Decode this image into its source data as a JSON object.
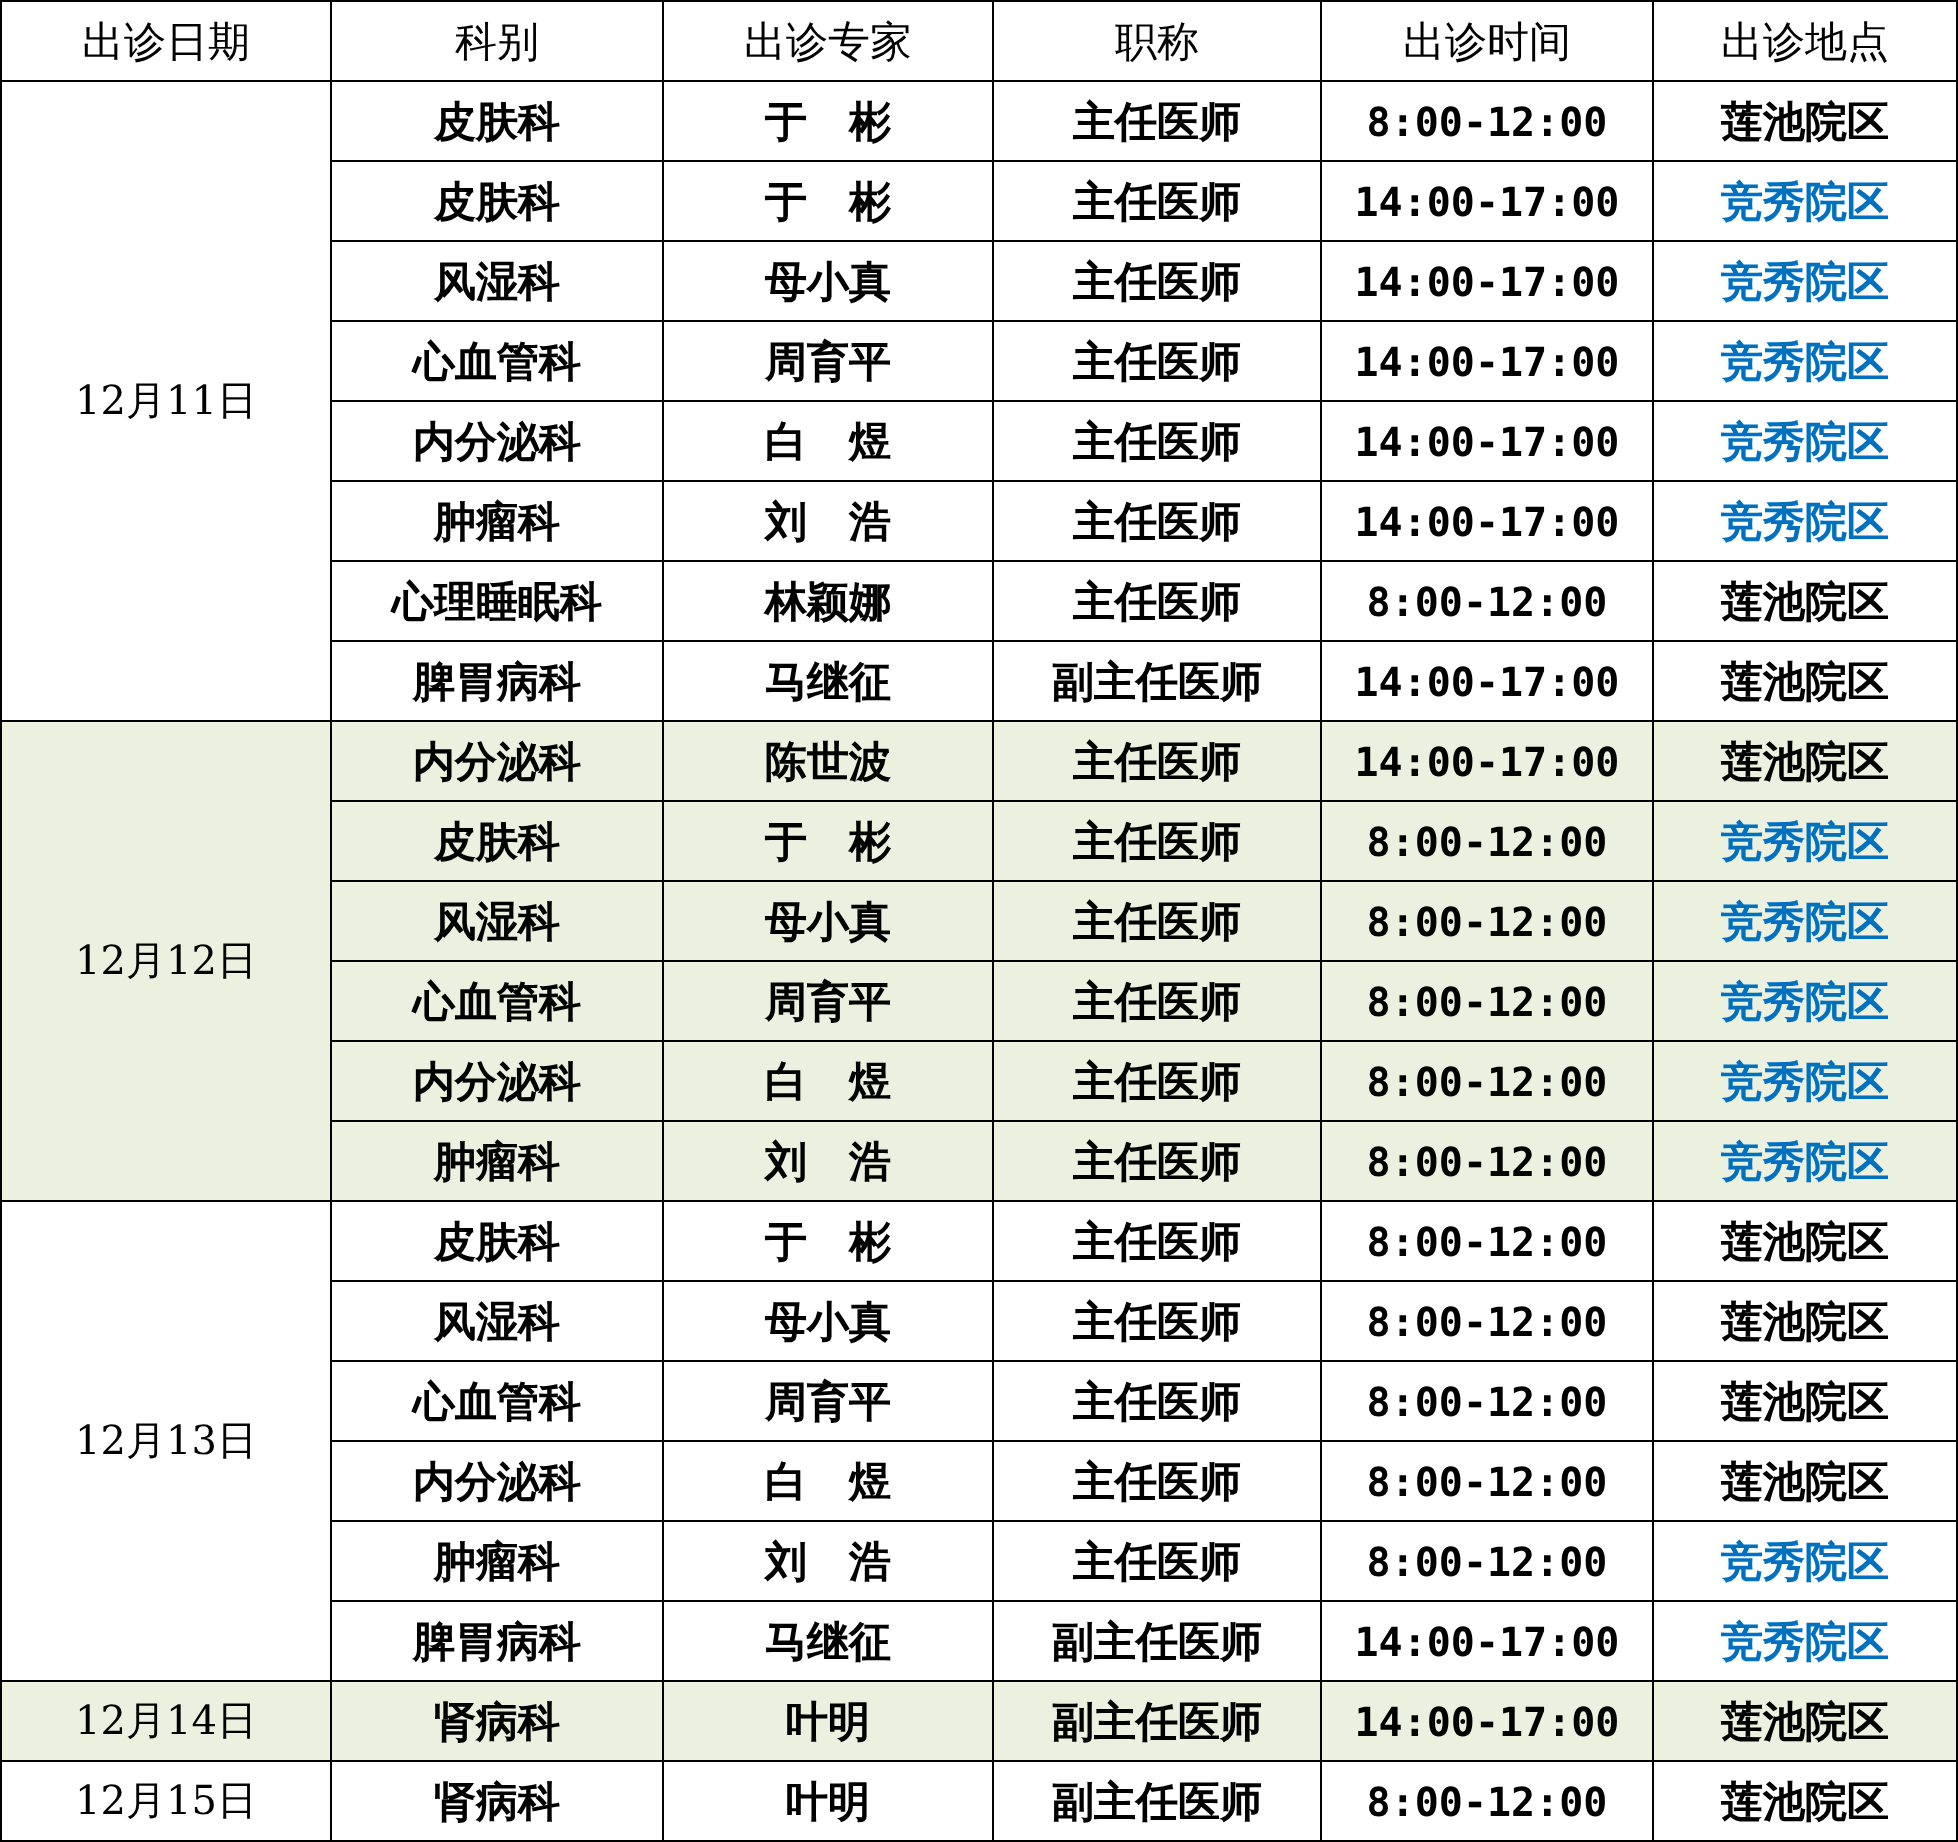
{
  "table": {
    "columns": [
      "出诊日期",
      "科别",
      "出诊专家",
      "职称",
      "出诊时间",
      "出诊地点"
    ],
    "groups": [
      {
        "date": "12月11日",
        "shaded": false,
        "rows": [
          {
            "dept": "皮肤科",
            "doctor": "于　彬",
            "title": "主任医师",
            "time": "8:00-12:00",
            "location": {
              "text": "莲池院区",
              "color": "#000000"
            }
          },
          {
            "dept": "皮肤科",
            "doctor": "于　彬",
            "title": "主任医师",
            "time": "14:00-17:00",
            "location": {
              "text": "竞秀院区",
              "color": "#0070c0"
            }
          },
          {
            "dept": "风湿科",
            "doctor": "母小真",
            "title": "主任医师",
            "time": "14:00-17:00",
            "location": {
              "text": "竞秀院区",
              "color": "#0070c0"
            }
          },
          {
            "dept": "心血管科",
            "doctor": "周育平",
            "title": "主任医师",
            "time": "14:00-17:00",
            "location": {
              "text": "竞秀院区",
              "color": "#0070c0"
            }
          },
          {
            "dept": "内分泌科",
            "doctor": "白　煜",
            "title": "主任医师",
            "time": "14:00-17:00",
            "location": {
              "text": "竞秀院区",
              "color": "#0070c0"
            }
          },
          {
            "dept": "肿瘤科",
            "doctor": "刘　浩",
            "title": "主任医师",
            "time": "14:00-17:00",
            "location": {
              "text": "竞秀院区",
              "color": "#0070c0"
            }
          },
          {
            "dept": "心理睡眠科",
            "doctor": "林颖娜",
            "title": "主任医师",
            "time": "8:00-12:00",
            "location": {
              "text": "莲池院区",
              "color": "#000000"
            }
          },
          {
            "dept": "脾胃病科",
            "doctor": "马继征",
            "title": "副主任医师",
            "time": "14:00-17:00",
            "location": {
              "text": "莲池院区",
              "color": "#000000"
            }
          }
        ]
      },
      {
        "date": "12月12日",
        "shaded": true,
        "rows": [
          {
            "dept": "内分泌科",
            "doctor": "陈世波",
            "title": "主任医师",
            "time": "14:00-17:00",
            "location": {
              "text": "莲池院区",
              "color": "#000000"
            }
          },
          {
            "dept": "皮肤科",
            "doctor": "于　彬",
            "title": "主任医师",
            "time": "8:00-12:00",
            "location": {
              "text": "竞秀院区",
              "color": "#0070c0"
            }
          },
          {
            "dept": "风湿科",
            "doctor": "母小真",
            "title": "主任医师",
            "time": "8:00-12:00",
            "location": {
              "text": "竞秀院区",
              "color": "#0070c0"
            }
          },
          {
            "dept": "心血管科",
            "doctor": "周育平",
            "title": "主任医师",
            "time": "8:00-12:00",
            "location": {
              "text": "竞秀院区",
              "color": "#0070c0"
            }
          },
          {
            "dept": "内分泌科",
            "doctor": "白　煜",
            "title": "主任医师",
            "time": "8:00-12:00",
            "location": {
              "text": "竞秀院区",
              "color": "#0070c0"
            }
          },
          {
            "dept": "肿瘤科",
            "doctor": "刘　浩",
            "title": "主任医师",
            "time": "8:00-12:00",
            "location": {
              "text": "竞秀院区",
              "color": "#0070c0"
            }
          }
        ]
      },
      {
        "date": "12月13日",
        "shaded": false,
        "rows": [
          {
            "dept": "皮肤科",
            "doctor": "于　彬",
            "title": "主任医师",
            "time": "8:00-12:00",
            "location": {
              "text": "莲池院区",
              "color": "#000000"
            }
          },
          {
            "dept": "风湿科",
            "doctor": "母小真",
            "title": "主任医师",
            "time": "8:00-12:00",
            "location": {
              "text": "莲池院区",
              "color": "#000000"
            }
          },
          {
            "dept": "心血管科",
            "doctor": "周育平",
            "title": "主任医师",
            "time": "8:00-12:00",
            "location": {
              "text": "莲池院区",
              "color": "#000000"
            }
          },
          {
            "dept": "内分泌科",
            "doctor": "白　煜",
            "title": "主任医师",
            "time": "8:00-12:00",
            "location": {
              "text": "莲池院区",
              "color": "#000000"
            }
          },
          {
            "dept": "肿瘤科",
            "doctor": "刘　浩",
            "title": "主任医师",
            "time": "8:00-12:00",
            "location": {
              "text": "竞秀院区",
              "color": "#0070c0"
            }
          },
          {
            "dept": "脾胃病科",
            "doctor": "马继征",
            "title": "副主任医师",
            "time": "14:00-17:00",
            "location": {
              "text": "竞秀院区",
              "color": "#0070c0"
            }
          }
        ]
      },
      {
        "date": "12月14日",
        "shaded": true,
        "rows": [
          {
            "dept": "肾病科",
            "doctor": "叶明",
            "title": "副主任医师",
            "time": "14:00-17:00",
            "location": {
              "text": "莲池院区",
              "color": "#000000"
            }
          }
        ]
      },
      {
        "date": "12月15日",
        "shaded": false,
        "rows": [
          {
            "dept": "肾病科",
            "doctor": "叶明",
            "title": "副主任医师",
            "time": "8:00-12:00",
            "location": {
              "text": "莲池院区",
              "color": "#000000"
            }
          }
        ]
      }
    ]
  }
}
